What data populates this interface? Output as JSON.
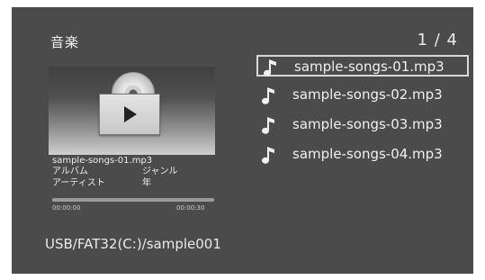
{
  "header": {
    "title": "音楽",
    "page_indicator": "1 / 4"
  },
  "preview": {
    "file_name": "sample-songs-01.mp3",
    "album_label": "アルバム",
    "genre_label": "ジャンル",
    "artist_label": "アーティスト",
    "year_label": "年",
    "time_elapsed": "00:00:00",
    "time_total": "00:00:30",
    "progress_fraction": 0
  },
  "playlist": {
    "items": [
      {
        "label": "sample-songs-01.mp3",
        "selected": true
      },
      {
        "label": "sample-songs-02.mp3",
        "selected": false
      },
      {
        "label": "sample-songs-03.mp3",
        "selected": false
      },
      {
        "label": "sample-songs-04.mp3",
        "selected": false
      }
    ]
  },
  "footer": {
    "path": "USB/FAT32(C:)/sample001"
  },
  "icons": {
    "track": "music-note-icon",
    "preview": "disc-case-play-icon"
  },
  "colors": {
    "background": "#4b4b4b",
    "text": "#f0f0f0",
    "selection_border": "#d8d8d8"
  }
}
